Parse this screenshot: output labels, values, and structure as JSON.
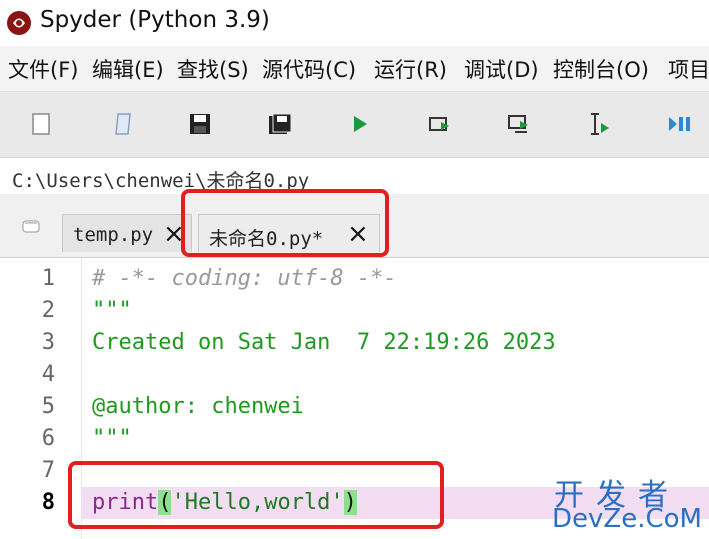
{
  "window": {
    "title": "Spyder (Python 3.9)"
  },
  "menubar": {
    "items": [
      "文件(F)",
      "编辑(E)",
      "查找(S)",
      "源代码(C)",
      "运行(R)",
      "调试(D)",
      "控制台(O)",
      "项目"
    ]
  },
  "toolbar": {
    "buttons": [
      "new-file-icon",
      "open-file-icon",
      "save-icon",
      "save-all-icon",
      "run-icon",
      "run-cell-icon",
      "run-cell-advance-icon",
      "run-selection-icon",
      "debug-continue-icon"
    ]
  },
  "path": "C:\\Users\\chenwei\\未命名0.py",
  "tabs": [
    {
      "label": "temp.py",
      "active": false
    },
    {
      "label": "未命名0.py*",
      "active": true
    }
  ],
  "tab_close_glyph": "×",
  "editor": {
    "line_numbers": [
      "1",
      "2",
      "3",
      "4",
      "5",
      "6",
      "7",
      "8"
    ],
    "current_line": "8",
    "lines": {
      "l1": "# -*- coding: utf-8 -*-",
      "l2": "\"\"\"",
      "l3": "Created on Sat Jan  7 22:19:26 2023",
      "l4": "",
      "l5": "@author: chenwei",
      "l6": "\"\"\"",
      "l7": "",
      "l8_kw": "print",
      "l8_open": "(",
      "l8_str": "'Hello,world'",
      "l8_close": ")"
    }
  },
  "watermark": {
    "cn": "开发者",
    "en": "DevZe.CoM"
  },
  "colors": {
    "annotation": "#e02020",
    "watermark": "#2a6fc4",
    "docstring": "#1f9a1f",
    "keyword": "#8a2a8a"
  }
}
